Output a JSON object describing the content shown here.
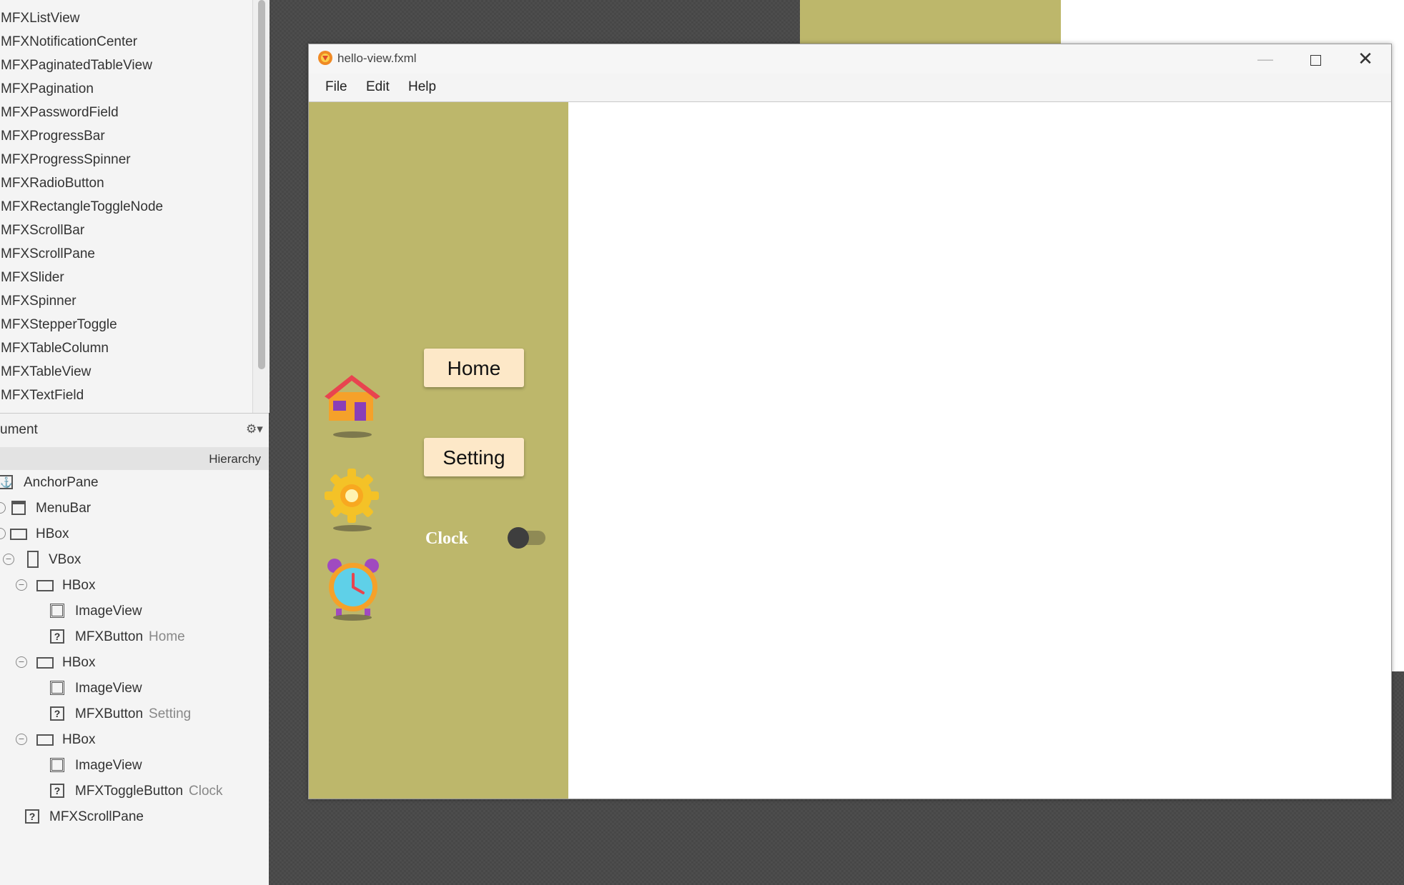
{
  "library": {
    "items": [
      "MFXListView",
      "MFXNotificationCenter",
      "MFXPaginatedTableView",
      "MFXPagination",
      "MFXPasswordField",
      "MFXProgressBar",
      "MFXProgressSpinner",
      "MFXRadioButton",
      "MFXRectangleToggleNode",
      "MFXScrollBar",
      "MFXScrollPane",
      "MFXSlider",
      "MFXSpinner",
      "MFXStepperToggle",
      "MFXTableColumn",
      "MFXTableView",
      "MFXTextField"
    ]
  },
  "document": {
    "title": "ument",
    "hierarchy_label": "Hierarchy"
  },
  "tree": [
    {
      "label": "AnchorPane",
      "sub": "",
      "icon": "anchor-icon"
    },
    {
      "label": "MenuBar",
      "sub": "",
      "icon": "menubar-icon"
    },
    {
      "label": "HBox",
      "sub": "",
      "icon": "hbox-icon"
    },
    {
      "label": "VBox",
      "sub": "",
      "icon": "vbox-icon"
    },
    {
      "label": "HBox",
      "sub": "",
      "icon": "hbox-icon"
    },
    {
      "label": "ImageView",
      "sub": "",
      "icon": "imageview-icon"
    },
    {
      "label": "MFXButton",
      "sub": "Home",
      "icon": "unknown-component-icon"
    },
    {
      "label": "HBox",
      "sub": "",
      "icon": "hbox-icon"
    },
    {
      "label": "ImageView",
      "sub": "",
      "icon": "imageview-icon"
    },
    {
      "label": "MFXButton",
      "sub": "Setting",
      "icon": "unknown-component-icon"
    },
    {
      "label": "HBox",
      "sub": "",
      "icon": "hbox-icon"
    },
    {
      "label": "ImageView",
      "sub": "",
      "icon": "imageview-icon"
    },
    {
      "label": "MFXToggleButton",
      "sub": "Clock",
      "icon": "unknown-component-icon"
    },
    {
      "label": "MFXScrollPane",
      "sub": "",
      "icon": "unknown-component-icon"
    }
  ],
  "window": {
    "title": "hello-view.fxml",
    "menu": [
      "File",
      "Edit",
      "Help"
    ]
  },
  "sidebar": {
    "home_label": "Home",
    "setting_label": "Setting",
    "clock_label": "Clock",
    "clock_toggle_on": false
  },
  "colors": {
    "sidebar_bg": "#bdb76b",
    "button_bg": "#fde8c8",
    "content_bg": "#ffffff"
  }
}
